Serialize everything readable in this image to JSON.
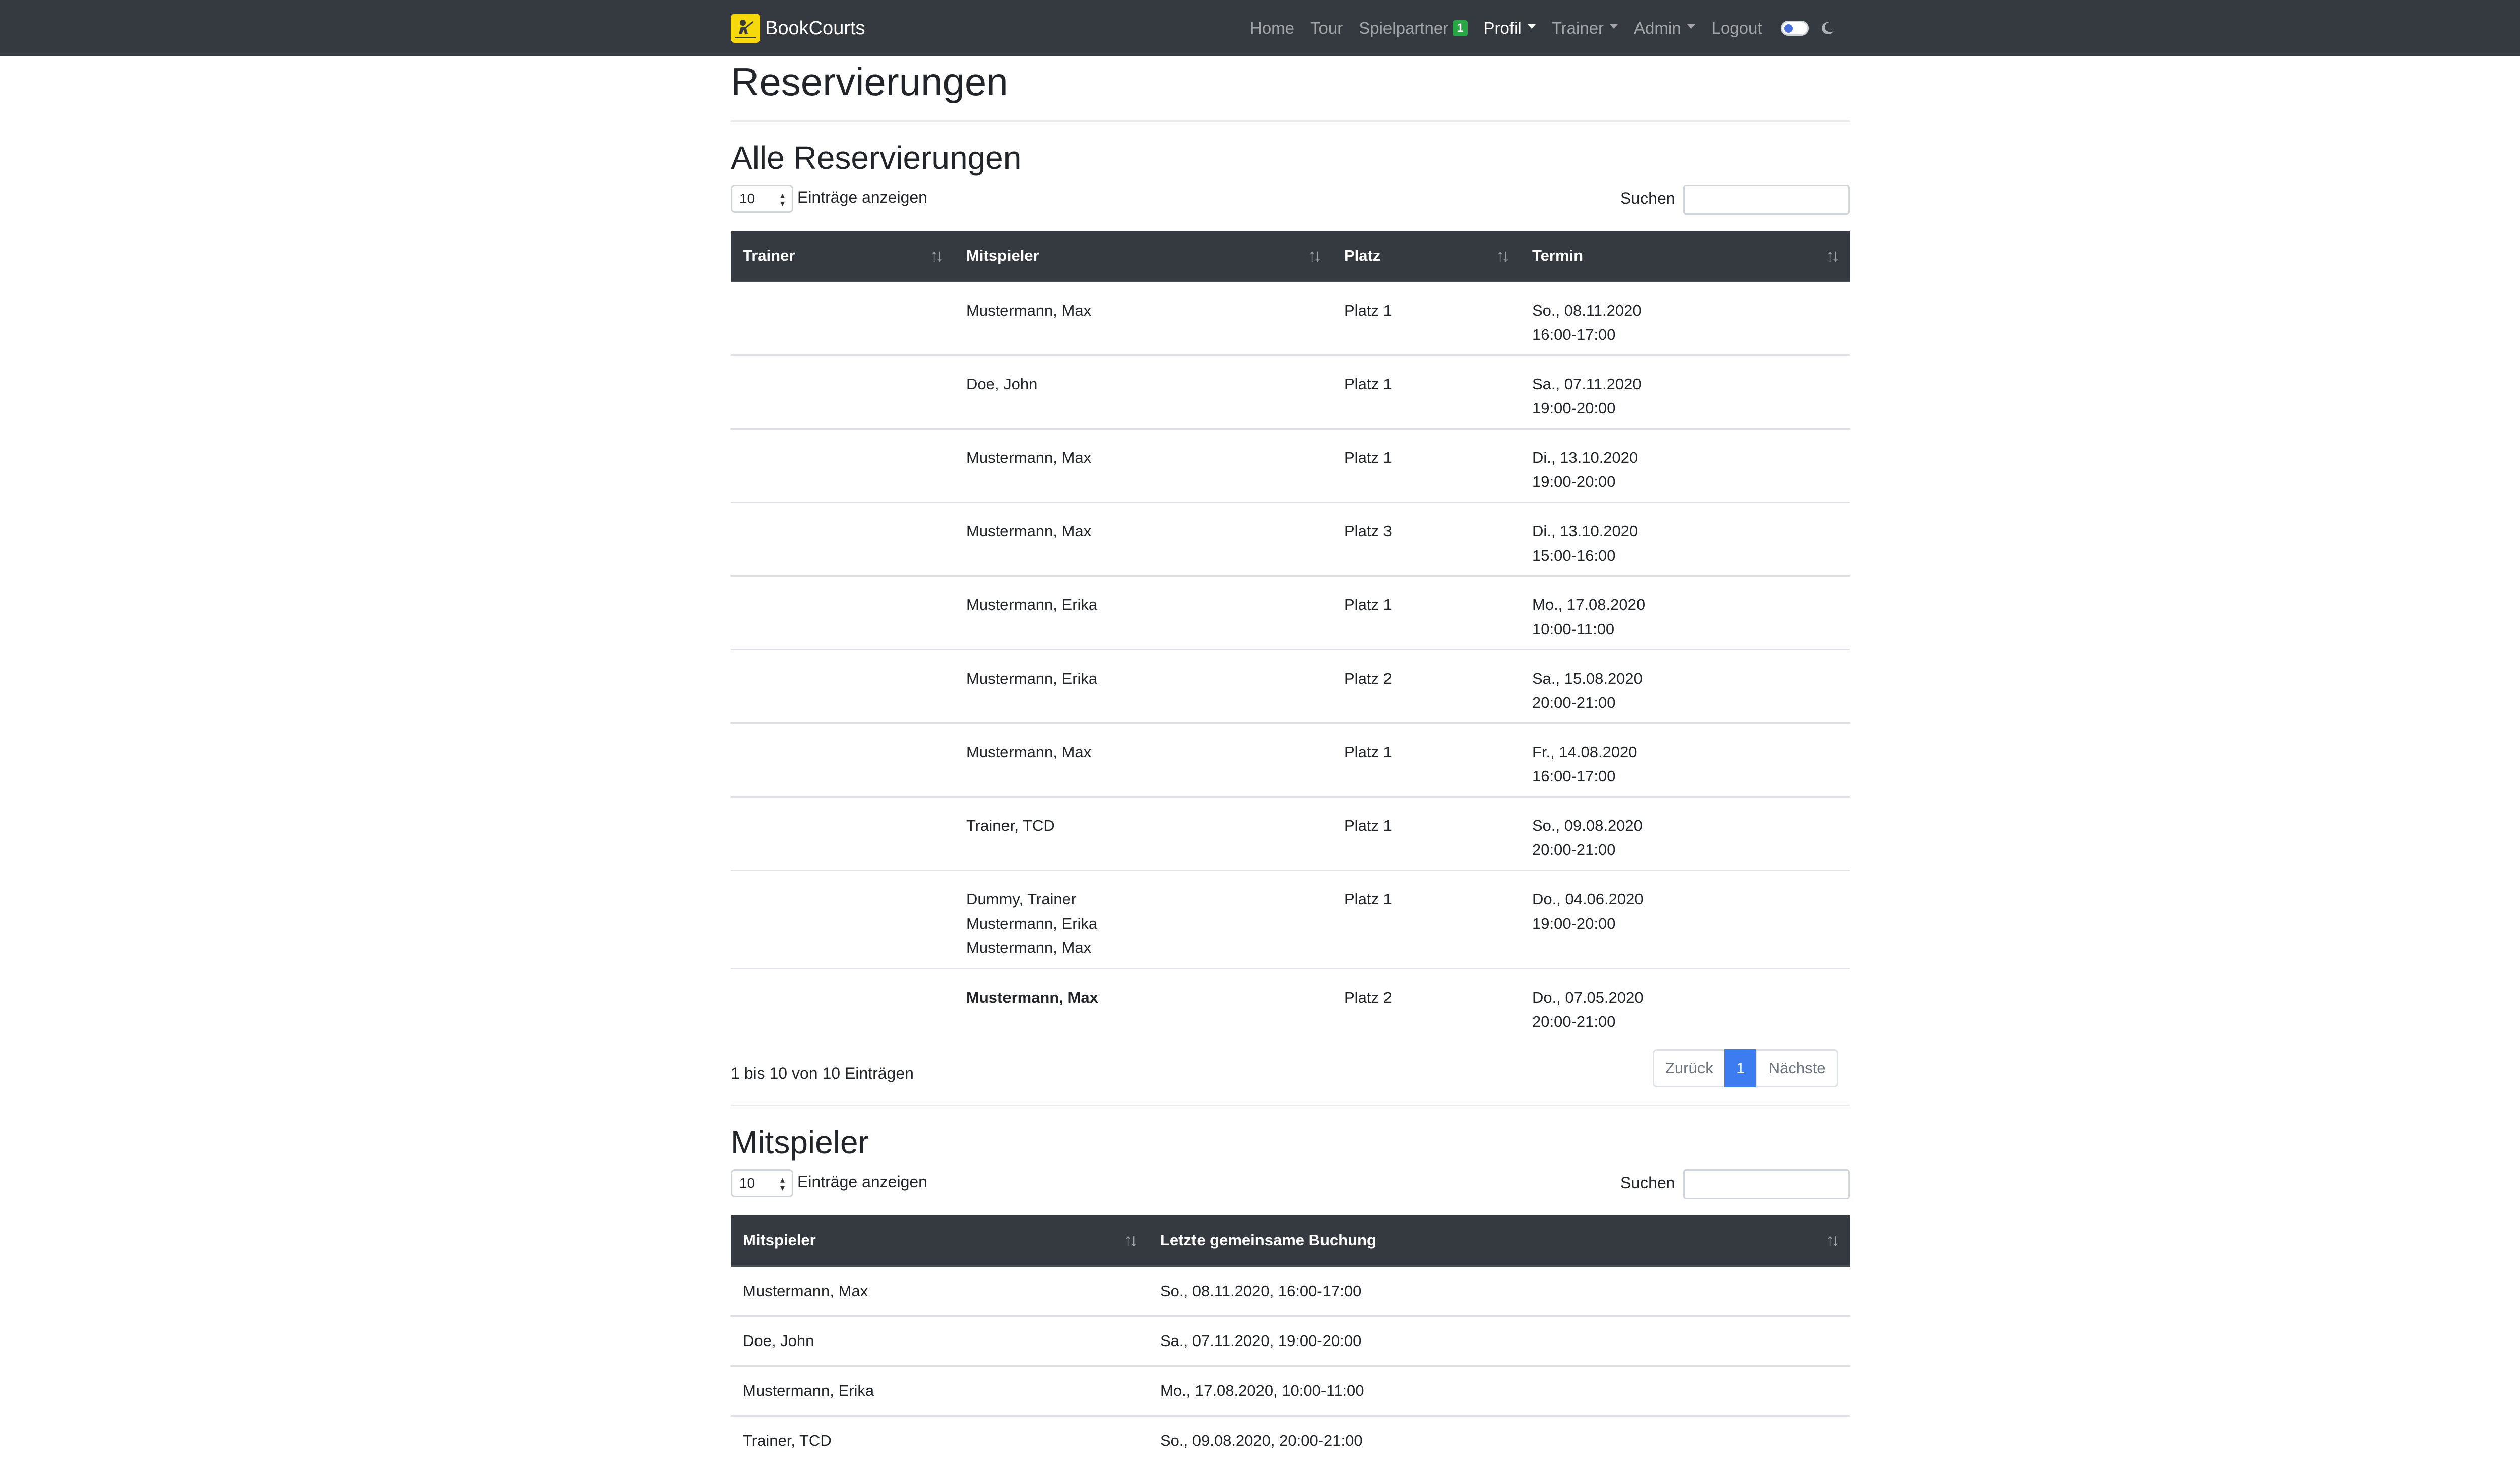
{
  "navbar": {
    "brand": "BookCourts",
    "items": [
      {
        "label": "Home",
        "active": false,
        "dropdown": false
      },
      {
        "label": "Tour",
        "active": false,
        "dropdown": false
      },
      {
        "label": "Spielpartner",
        "active": false,
        "dropdown": false,
        "badge": "1"
      },
      {
        "label": "Profil",
        "active": true,
        "dropdown": true
      },
      {
        "label": "Trainer",
        "active": false,
        "dropdown": true
      },
      {
        "label": "Admin",
        "active": false,
        "dropdown": true
      },
      {
        "label": "Logout",
        "active": false,
        "dropdown": false
      }
    ],
    "theme_toggle_icon": "toggle-switch-icon",
    "dark_mode_icon": "moon-icon"
  },
  "page": {
    "title": "Reservierungen"
  },
  "reservations": {
    "heading": "Alle Reservierungen",
    "length_value": "10",
    "length_label": "Einträge anzeigen",
    "search_label": "Suchen",
    "search_value": "",
    "columns": [
      "Trainer",
      "Mitspieler",
      "Platz",
      "Termin"
    ],
    "rows": [
      {
        "trainer": "",
        "mitspieler": [
          "Mustermann, Max"
        ],
        "platz": "Platz 1",
        "termin": [
          "So., 08.11.2020",
          "16:00-17:00"
        ],
        "bold": false
      },
      {
        "trainer": "",
        "mitspieler": [
          "Doe, John"
        ],
        "platz": "Platz 1",
        "termin": [
          "Sa., 07.11.2020",
          "19:00-20:00"
        ],
        "bold": false
      },
      {
        "trainer": "",
        "mitspieler": [
          "Mustermann, Max"
        ],
        "platz": "Platz 1",
        "termin": [
          "Di., 13.10.2020",
          "19:00-20:00"
        ],
        "bold": false
      },
      {
        "trainer": "",
        "mitspieler": [
          "Mustermann, Max"
        ],
        "platz": "Platz 3",
        "termin": [
          "Di., 13.10.2020",
          "15:00-16:00"
        ],
        "bold": false
      },
      {
        "trainer": "",
        "mitspieler": [
          "Mustermann, Erika"
        ],
        "platz": "Platz 1",
        "termin": [
          "Mo., 17.08.2020",
          "10:00-11:00"
        ],
        "bold": false
      },
      {
        "trainer": "",
        "mitspieler": [
          "Mustermann, Erika"
        ],
        "platz": "Platz 2",
        "termin": [
          "Sa., 15.08.2020",
          "20:00-21:00"
        ],
        "bold": false
      },
      {
        "trainer": "",
        "mitspieler": [
          "Mustermann, Max"
        ],
        "platz": "Platz 1",
        "termin": [
          "Fr., 14.08.2020",
          "16:00-17:00"
        ],
        "bold": false
      },
      {
        "trainer": "",
        "mitspieler": [
          "Trainer, TCD"
        ],
        "platz": "Platz 1",
        "termin": [
          "So., 09.08.2020",
          "20:00-21:00"
        ],
        "bold": false
      },
      {
        "trainer": "",
        "mitspieler": [
          "Dummy, Trainer",
          "Mustermann, Erika",
          "Mustermann, Max"
        ],
        "platz": "Platz 1",
        "termin": [
          "Do., 04.06.2020",
          "19:00-20:00"
        ],
        "bold": false
      },
      {
        "trainer": "",
        "mitspieler": [
          "Mustermann, Max"
        ],
        "platz": "Platz 2",
        "termin": [
          "Do., 07.05.2020",
          "20:00-21:00"
        ],
        "bold": true
      }
    ],
    "info": "1 bis 10 von 10 Einträgen",
    "pagination": {
      "prev": "Zurück",
      "current": "1",
      "next": "Nächste"
    }
  },
  "partners": {
    "heading": "Mitspieler",
    "length_value": "10",
    "length_label": "Einträge anzeigen",
    "search_label": "Suchen",
    "search_value": "",
    "columns": [
      "Mitspieler",
      "Letzte gemeinsame Buchung"
    ],
    "rows": [
      {
        "name": "Mustermann, Max",
        "last": "So., 08.11.2020, 16:00-17:00"
      },
      {
        "name": "Doe, John",
        "last": "Sa., 07.11.2020, 19:00-20:00"
      },
      {
        "name": "Mustermann, Erika",
        "last": "Mo., 17.08.2020, 10:00-11:00"
      },
      {
        "name": "Trainer, TCD",
        "last": "So., 09.08.2020, 20:00-21:00"
      }
    ]
  },
  "colors": {
    "navbar": "#343a40",
    "accent": "#3d7cf0",
    "badge": "#28a745",
    "logo": "#f5d90a"
  }
}
